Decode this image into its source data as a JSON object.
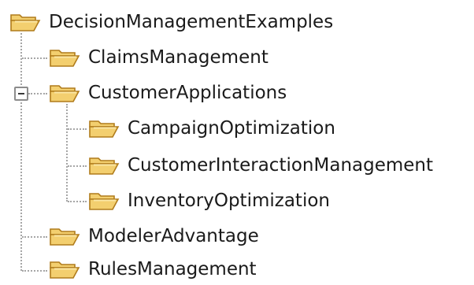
{
  "tree": {
    "root": {
      "label": "DecisionManagementExamples",
      "icon": "open-folder-icon",
      "expanded": true
    },
    "children": [
      {
        "label": "ClaimsManagement",
        "icon": "open-folder-icon"
      },
      {
        "label": "CustomerApplications",
        "icon": "open-folder-icon",
        "expanded": true,
        "expander_icon": "collapse-minus-icon",
        "children": [
          {
            "label": "CampaignOptimization",
            "icon": "open-folder-icon"
          },
          {
            "label": "CustomerInteractionManagement",
            "icon": "open-folder-icon"
          },
          {
            "label": "InventoryOptimization",
            "icon": "open-folder-icon"
          }
        ]
      },
      {
        "label": "ModelerAdvantage",
        "icon": "open-folder-icon"
      },
      {
        "label": "RulesManagement",
        "icon": "open-folder-icon"
      }
    ]
  },
  "colors": {
    "folder_fill": "#f3cf6f",
    "folder_light": "#fbe7a6",
    "folder_outline": "#b07c1c",
    "guide_line": "#a6a6a6",
    "text": "#1a1a1a"
  }
}
